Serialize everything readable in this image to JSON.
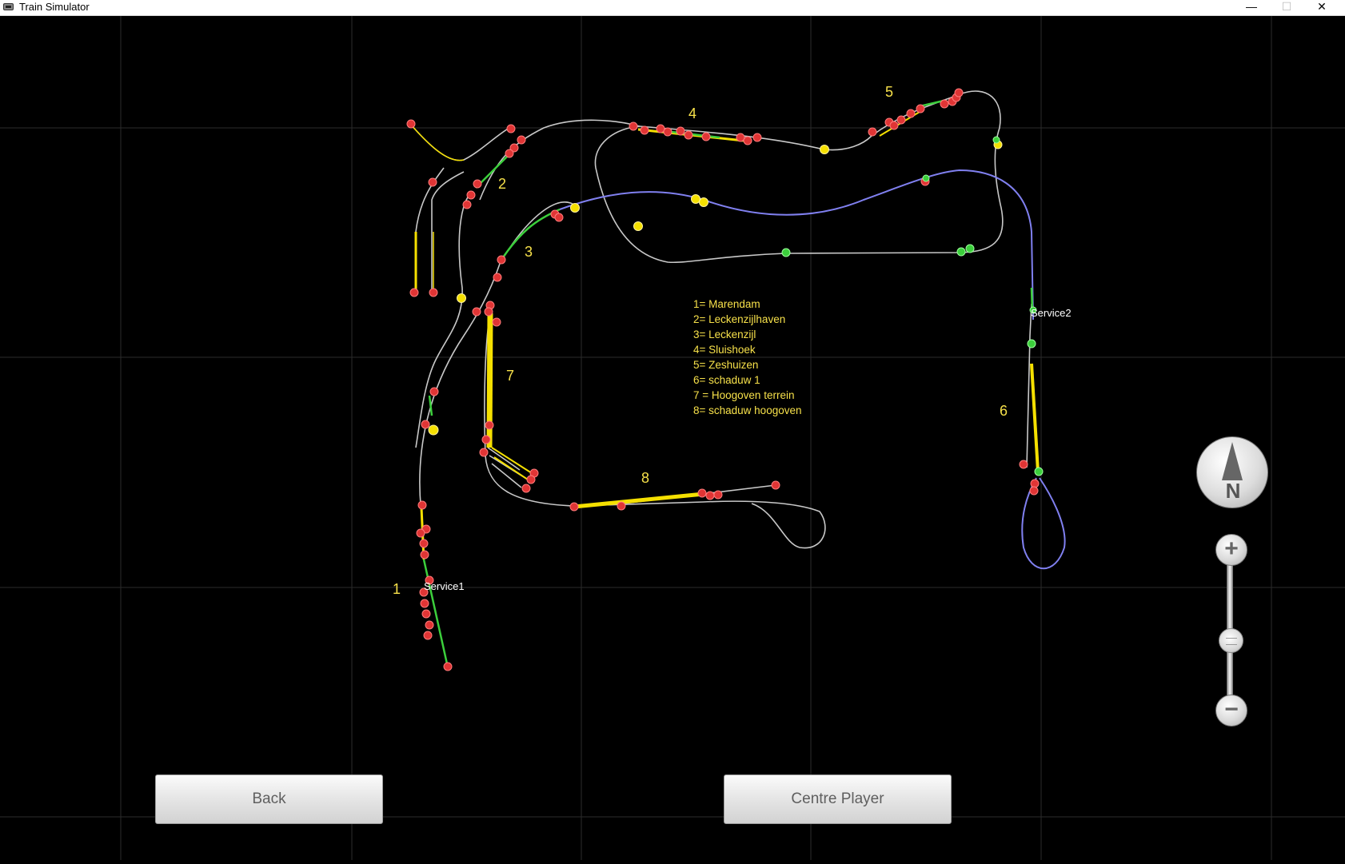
{
  "window": {
    "title": "Train Simulator",
    "minimize": "—",
    "maximize": "☐",
    "close": "✕"
  },
  "map": {
    "area_numbers": [
      "1",
      "2",
      "3",
      "4",
      "5",
      "6",
      "7",
      "8"
    ],
    "service_labels": [
      "Service1",
      "Service2"
    ],
    "legend": [
      "1= Marendam",
      "2= Leckenzijlhaven",
      "3= Leckenzijl",
      "4= Sluishoek",
      "5= Zeshuizen",
      "6= schaduw 1",
      "7 = Hoogoven terrein",
      "8= schaduw hoogoven"
    ],
    "colors": {
      "track": "#c8c8c8",
      "player_route": "#8080f0",
      "platform": "#f5e000",
      "active_section": "#3ccf3c",
      "signal_red": "#e03535",
      "signal_yellow": "#f5e000",
      "signal_green": "#3ccf3c",
      "label": "#f7e14a"
    }
  },
  "controls": {
    "back_label": "Back",
    "centre_player_label": "Centre Player",
    "compass_letter": "N",
    "zoom_in": "+",
    "zoom_out": "−"
  }
}
